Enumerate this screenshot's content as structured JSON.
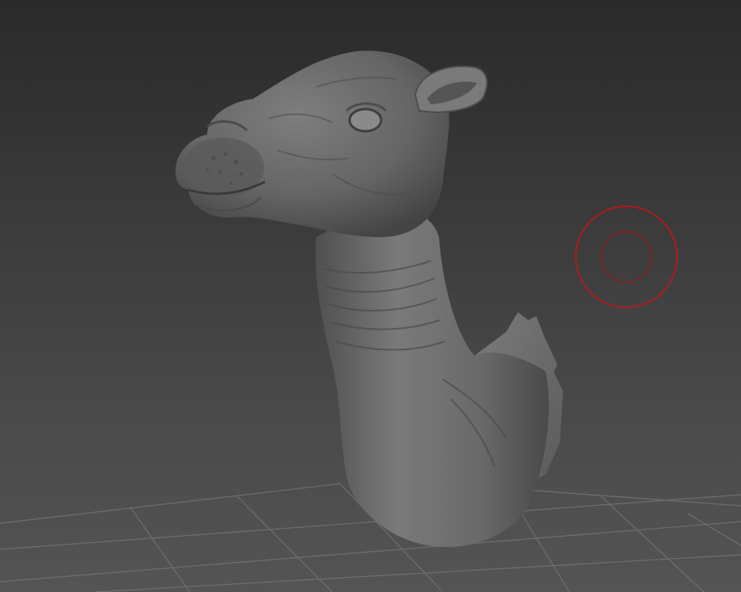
{
  "viewport": {
    "background_top": "#2a2a2a",
    "background_bottom": "#545454",
    "grid_color": "#7a7a7a",
    "brush_cursor_color": "#b01c1c",
    "model_base_color": "#6e6e6e"
  },
  "scene": {
    "model": "sculpted-camel-head-and-neck",
    "floor": "perspective-grid",
    "cursor": "brush-circle"
  }
}
